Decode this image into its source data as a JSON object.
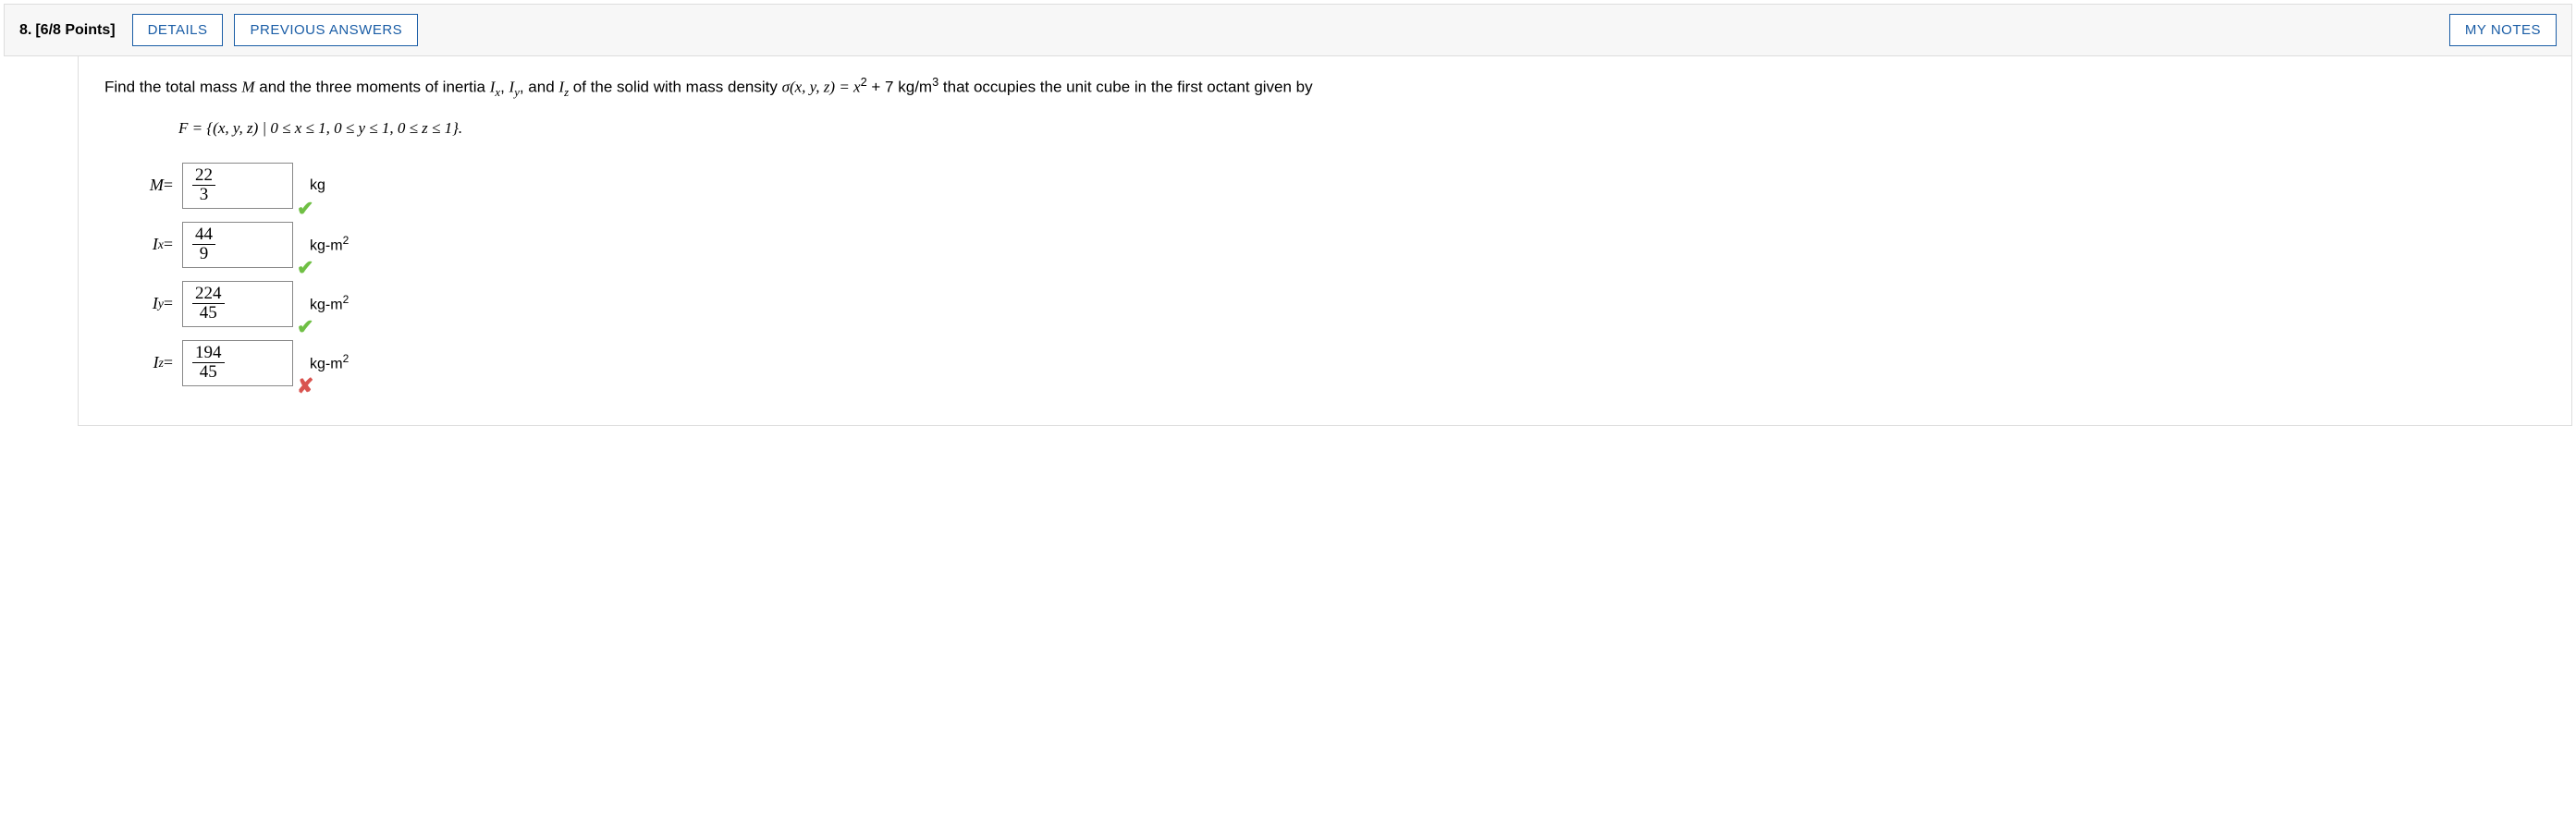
{
  "header": {
    "number": "8.",
    "points": "[6/8 Points]",
    "details": "DETAILS",
    "previous": "PREVIOUS ANSWERS",
    "notes": "MY NOTES"
  },
  "prompt": {
    "p1": "Find the total mass ",
    "M": "M",
    "p2": " and the three moments of inertia ",
    "Ix": "I",
    "Ixs": "x",
    "comma1": ", ",
    "Iy": "I",
    "Iys": "y",
    "comma2": ", and ",
    "Iz": "I",
    "Izs": "z",
    "p3": " of the solid with mass density ",
    "sigma": "σ(x, y, z) = x",
    "sq": "2",
    "p4": " + 7 kg/m",
    "cube": "3",
    "p5": " that occupies the unit cube in the first octant given by"
  },
  "setdef": "F = {(x, y, z) | 0 ≤ x ≤ 1, 0 ≤ y ≤ 1, 0 ≤ z ≤ 1}.",
  "answers": {
    "M": {
      "label": "M",
      "sub": "",
      "eq": " = ",
      "num": "22",
      "den": "3",
      "unit": "kg",
      "status": "correct"
    },
    "Ix": {
      "label": "I",
      "sub": "x",
      "eq": " = ",
      "num": "44",
      "den": "9",
      "unit": "kg-m",
      "unit_sup": "2",
      "status": "correct"
    },
    "Iy": {
      "label": "I",
      "sub": "y",
      "eq": " = ",
      "num": "224",
      "den": "45",
      "unit": "kg-m",
      "unit_sup": "2",
      "status": "correct"
    },
    "Iz": {
      "label": "I",
      "sub": "z",
      "eq": " = ",
      "num": "194",
      "den": "45",
      "unit": "kg-m",
      "unit_sup": "2",
      "status": "incorrect"
    }
  },
  "icons": {
    "check": "✔",
    "cross": "✘"
  }
}
